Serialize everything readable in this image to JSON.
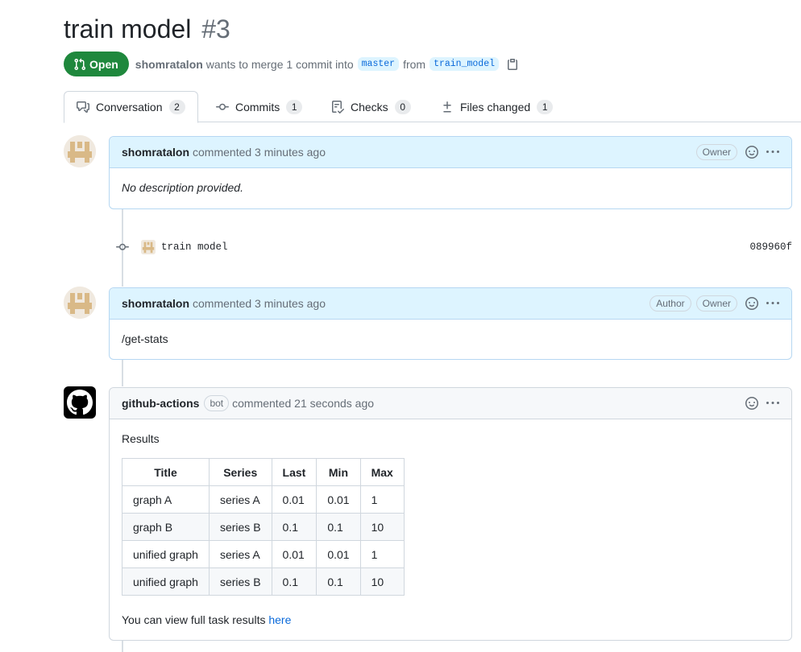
{
  "pr": {
    "title": "train model",
    "number": "#3",
    "state": "Open",
    "author": "shomratalon",
    "merge_text": "wants to merge 1 commit into",
    "base_branch": "master",
    "from_text": "from",
    "head_branch": "train_model"
  },
  "tabs": [
    {
      "label": "Conversation",
      "count": "2",
      "icon": "comment-discussion-icon"
    },
    {
      "label": "Commits",
      "count": "1",
      "icon": "git-commit-icon"
    },
    {
      "label": "Checks",
      "count": "0",
      "icon": "checklist-icon"
    },
    {
      "label": "Files changed",
      "count": "1",
      "icon": "file-diff-icon"
    }
  ],
  "comments": [
    {
      "author": "shomratalon",
      "action": "commented 3 minutes ago",
      "labels": [
        "Owner"
      ],
      "body": "No description provided."
    },
    {
      "author": "shomratalon",
      "action": "commented 3 minutes ago",
      "labels": [
        "Author",
        "Owner"
      ],
      "body": "/get-stats"
    },
    {
      "author": "github-actions",
      "bot_label": "bot",
      "action": "commented 21 seconds ago",
      "intro": "Results",
      "table": {
        "headers": [
          "Title",
          "Series",
          "Last",
          "Min",
          "Max"
        ],
        "rows": [
          [
            "graph A",
            "series A",
            "0.01",
            "0.01",
            "1"
          ],
          [
            "graph B",
            "series B",
            "0.1",
            "0.1",
            "10"
          ],
          [
            "unified graph",
            "series A",
            "0.01",
            "0.01",
            "1"
          ],
          [
            "unified graph",
            "series B",
            "0.1",
            "0.1",
            "10"
          ]
        ]
      },
      "footer_text": "You can view full task results",
      "footer_link": "here"
    }
  ],
  "commit": {
    "message": "train model",
    "sha": "089960f"
  },
  "colors": {
    "open_green": "#1f883d",
    "link_blue": "#0969da",
    "header_blue": "#ddf4ff"
  }
}
